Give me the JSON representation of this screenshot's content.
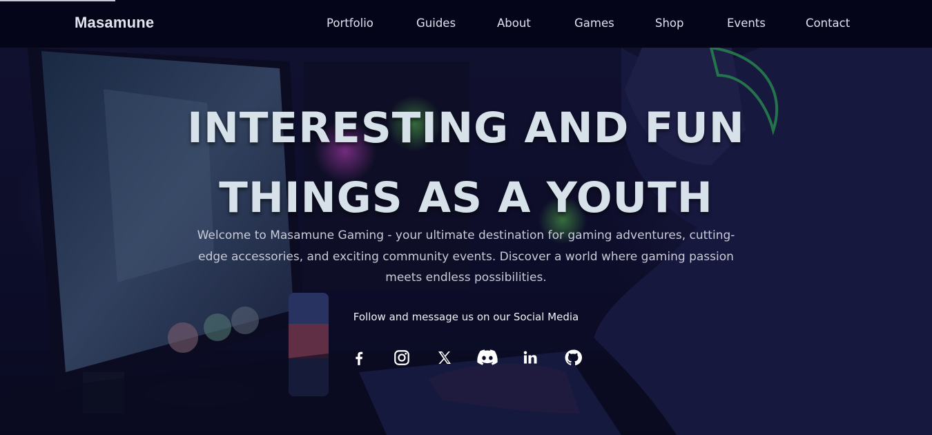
{
  "navbar": {
    "brand": "Masamune",
    "links": [
      {
        "label": "Portfolio"
      },
      {
        "label": "Guides"
      },
      {
        "label": "About"
      },
      {
        "label": "Games"
      },
      {
        "label": "Shop"
      },
      {
        "label": "Events"
      },
      {
        "label": "Contact"
      }
    ]
  },
  "hero": {
    "headline_line1": "INTERESTING AND FUN",
    "headline_line2": "THINGS AS A YOUTH",
    "intro": "Welcome to Masamune Gaming - your ultimate destination for gaming adventures, cutting-edge accessories, and exciting community events. Discover a world where gaming passion meets endless possibilities.",
    "follow_text": "Follow and message us on our Social Media",
    "social_icons": [
      "facebook-icon",
      "instagram-icon",
      "x-icon",
      "discord-icon",
      "linkedin-icon",
      "github-icon"
    ]
  },
  "colors": {
    "nav_background": "#05051a",
    "headline": "#d7e1ea",
    "body_text": "#c9cbd8",
    "icons": "#ffffff"
  }
}
